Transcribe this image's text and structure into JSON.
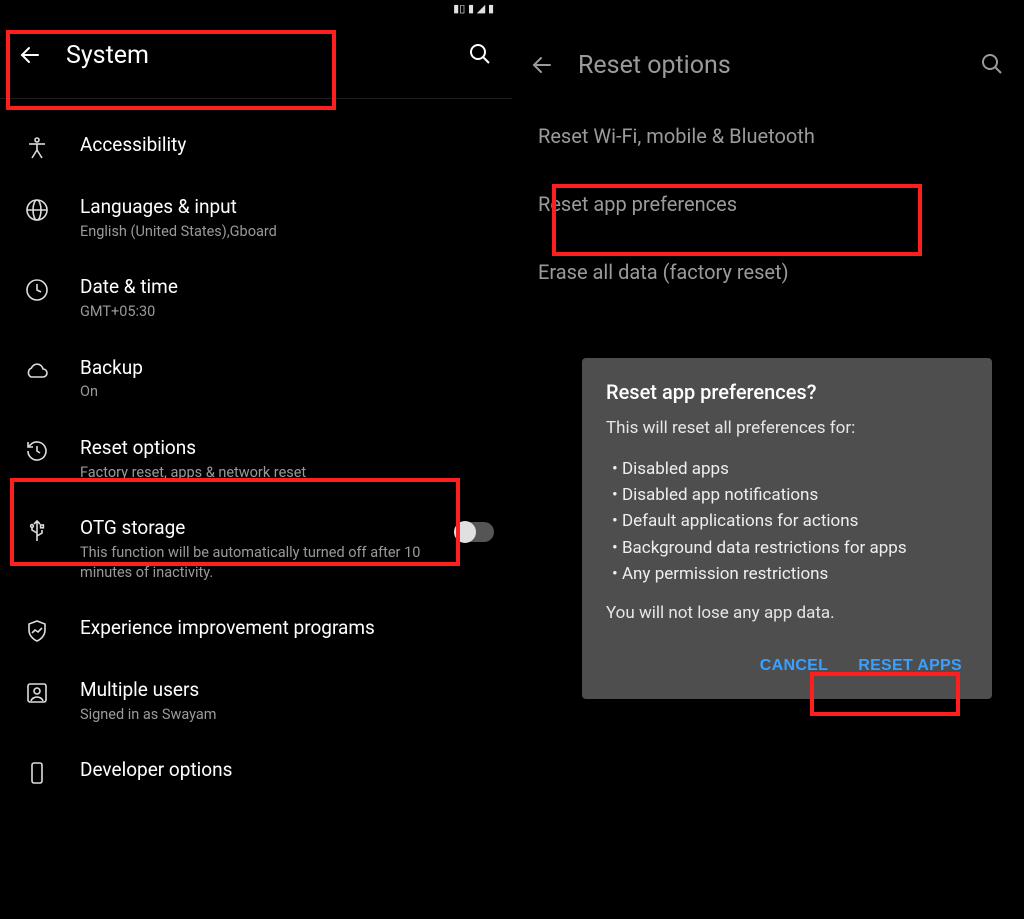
{
  "statusbar": {
    "time": ""
  },
  "left": {
    "title": "System",
    "items": [
      {
        "icon": "accessibility",
        "primary": "Accessibility",
        "secondary": ""
      },
      {
        "icon": "globe",
        "primary": "Languages & input",
        "secondary": "English (United States),Gboard"
      },
      {
        "icon": "clock",
        "primary": "Date & time",
        "secondary": "GMT+05:30"
      },
      {
        "icon": "cloud",
        "primary": "Backup",
        "secondary": "On"
      },
      {
        "icon": "history",
        "primary": "Reset options",
        "secondary": "Factory reset, apps & network reset"
      },
      {
        "icon": "usb",
        "primary": "OTG storage",
        "secondary": "This function will be automatically turned off after 10 minutes of inactivity.",
        "toggle": false
      },
      {
        "icon": "shield-chart",
        "primary": "Experience improvement programs",
        "secondary": ""
      },
      {
        "icon": "user-square",
        "primary": "Multiple users",
        "secondary": "Signed in as  Swayam"
      },
      {
        "icon": "phone",
        "primary": "Developer options",
        "secondary": ""
      }
    ]
  },
  "right": {
    "title": "Reset options",
    "rows": [
      "Reset Wi-Fi, mobile & Bluetooth",
      "Reset app preferences",
      "Erase all data (factory reset)"
    ],
    "dialog": {
      "title": "Reset app preferences?",
      "lead": "This will reset all preferences for:",
      "bullets": [
        "Disabled apps",
        "Disabled app notifications",
        "Default applications for actions",
        "Background data restrictions for apps",
        "Any permission restrictions"
      ],
      "footer": "You will not lose any app data.",
      "cancel": "CANCEL",
      "reset": "RESET APPS"
    }
  }
}
